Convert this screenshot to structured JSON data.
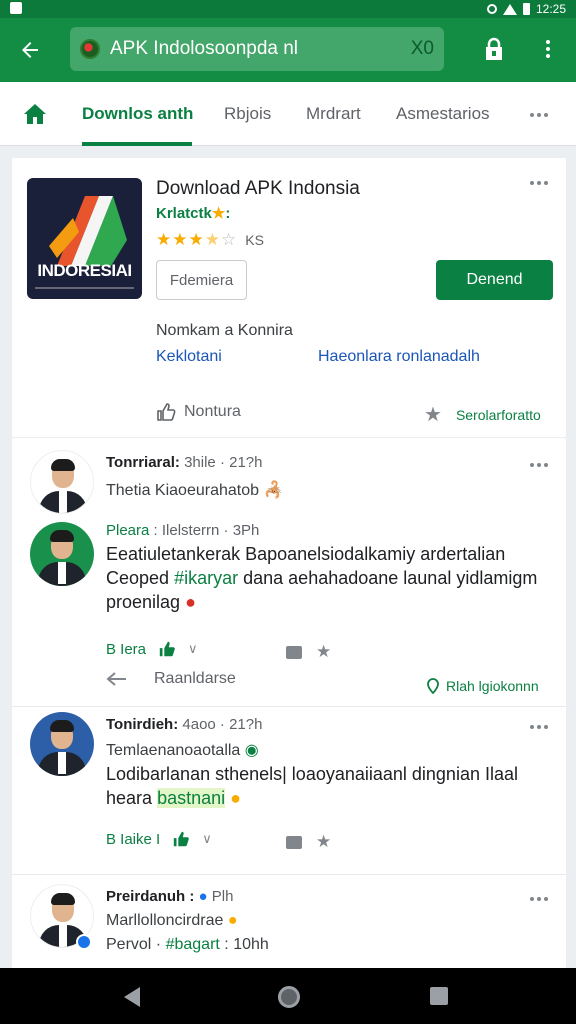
{
  "status_bar": {
    "time": "12:25"
  },
  "app_bar": {
    "search_value": "APK Indolosoonpda nl",
    "clear_label": "X0"
  },
  "tabs": [
    {
      "label": "Downlos anth",
      "active": true
    },
    {
      "label": "Rbjois",
      "active": false
    },
    {
      "label": "Mrdrart",
      "active": false
    },
    {
      "label": "Asmestarios",
      "active": false
    }
  ],
  "app_card": {
    "title": "Download APK Indonsia",
    "developer": "Krlatctk",
    "rating": 3.5,
    "rating_count": "KS",
    "icon_brand": "INDORESIAI",
    "secondary_button": "Fdemiera",
    "install_button": "Denend",
    "meta_line": "Nomkam a Konnira",
    "link_left": "Keklotani",
    "link_right": "Haeonlara ronlanadalh",
    "like_label": "Nontura",
    "save_label": "Serolarforatto"
  },
  "posts": [
    {
      "name": "Tonrriaral:",
      "time": "3hile · 21?h",
      "text": "Thetia Kiaoeurahatob 🦂",
      "style": "sub"
    },
    {
      "name": "Pleara",
      "time": ": Ilelsterrn · 3Ph",
      "text_prefix": "Eeatiuletankerak Bapoanelsiodalkamiy ardertalian Ceoped",
      "text_tag": "#ikaryar",
      "text_suffix": "dana aehahadoane launal yidlamigm proenilag",
      "react_label": "B Iera",
      "share_label": "Raanldarse",
      "follow_label": "Rlah lgiokonnn"
    },
    {
      "name": "Tonirdieh:",
      "time": "4aoo · 21?h",
      "subline": "Temlaenanoaotalla",
      "text_main": "Lodibarlanan sthenels| loaoyanaiiaanl dingnian Ilaal heara",
      "text_highlight": "bastnani",
      "react_label": "B Iaike I"
    },
    {
      "name": "Preirdanuh :",
      "time": "Plh",
      "subline": "Marllolloncirdrae",
      "subline2_prefix": "Pervol ·",
      "subline2_tag": "#bagart",
      "subline2_suffix": ": 10hh"
    }
  ],
  "colors": {
    "brand_green": "#138d44",
    "accent_green": "#0b8043",
    "link_blue": "#1a56b8",
    "star_gold": "#f9ab00"
  }
}
